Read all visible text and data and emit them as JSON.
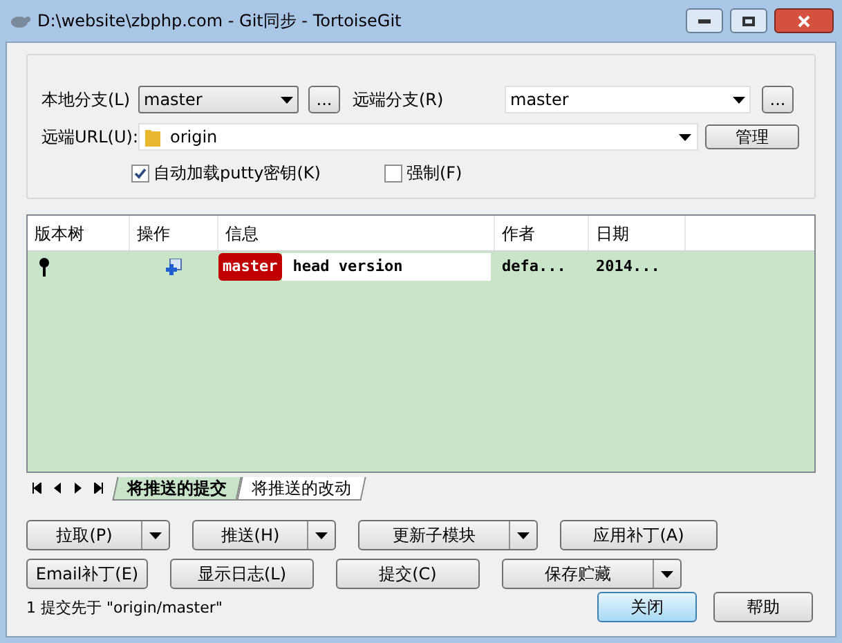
{
  "window": {
    "title": "D:\\website\\zbphp.com - Git同步 - TortoiseGit"
  },
  "local_branch": {
    "label": "本地分支(L)",
    "value": "master",
    "browse": "..."
  },
  "remote_branch": {
    "label": "远端分支(R)",
    "value": "master",
    "browse": "..."
  },
  "remote_url": {
    "label": "远端URL(U):",
    "value": "origin",
    "button": "管理"
  },
  "options": [
    {
      "label": "自动加载putty密钥(K)",
      "checked": true
    },
    {
      "label": "强制(F)",
      "checked": false
    }
  ],
  "table": {
    "columns": [
      "版本树",
      "操作",
      "信息",
      "作者",
      "日期"
    ],
    "rows": [
      {
        "tag": "master",
        "message": "head version",
        "author": "defa...",
        "date": "2014...",
        "selected": true
      }
    ]
  },
  "tabs": [
    {
      "label": "将推送的提交",
      "selected": true
    },
    {
      "label": "将推送的改动",
      "selected": false
    }
  ],
  "actions": [
    {
      "label": "拉取(P)",
      "kind": "split"
    },
    {
      "label": "推送(H)",
      "kind": "split"
    },
    {
      "label": "更新子模块",
      "kind": "split"
    },
    {
      "label": "应用补丁(A)",
      "kind": "plain"
    },
    {
      "label": "Email补丁(E)",
      "kind": "plain"
    },
    {
      "label": "显示日志(L)",
      "kind": "plain"
    },
    {
      "label": "提交(C)",
      "kind": "plain"
    },
    {
      "label": "保存贮藏",
      "kind": "split"
    }
  ],
  "status": "1 提交先于 \"origin/master\"",
  "dialog_buttons": [
    {
      "label": "关闭",
      "default": true
    },
    {
      "label": "帮助",
      "default": false
    }
  ]
}
